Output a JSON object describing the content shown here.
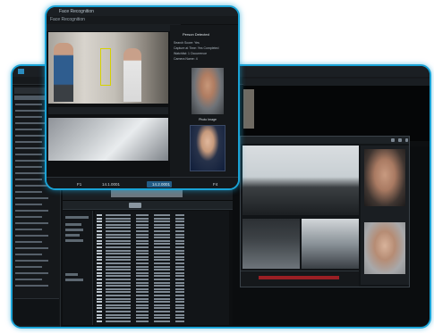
{
  "main_window": {
    "title": "",
    "sidebar_item_count": 30,
    "table_row_count": 34
  },
  "front_window": {
    "title": "Face Recognition",
    "menu": "Face Recognition",
    "video_bar": "",
    "info_title": "Person Detected",
    "info_rows": [
      "Search Score:   Yes",
      "Capture at Time:  Yes Completed",
      "Watchlist:  1 Occurrence",
      "Camera Name:  4"
    ],
    "face_label": "Photo Image",
    "status": {
      "left": "F1",
      "mid": "14.1.0001",
      "selected": "14.2.0001",
      "right": "F4"
    }
  },
  "colors": {
    "accent_border": "#1aa3d6",
    "window_bg": "#0d0f11",
    "timeline_red": "#9a1f24"
  }
}
